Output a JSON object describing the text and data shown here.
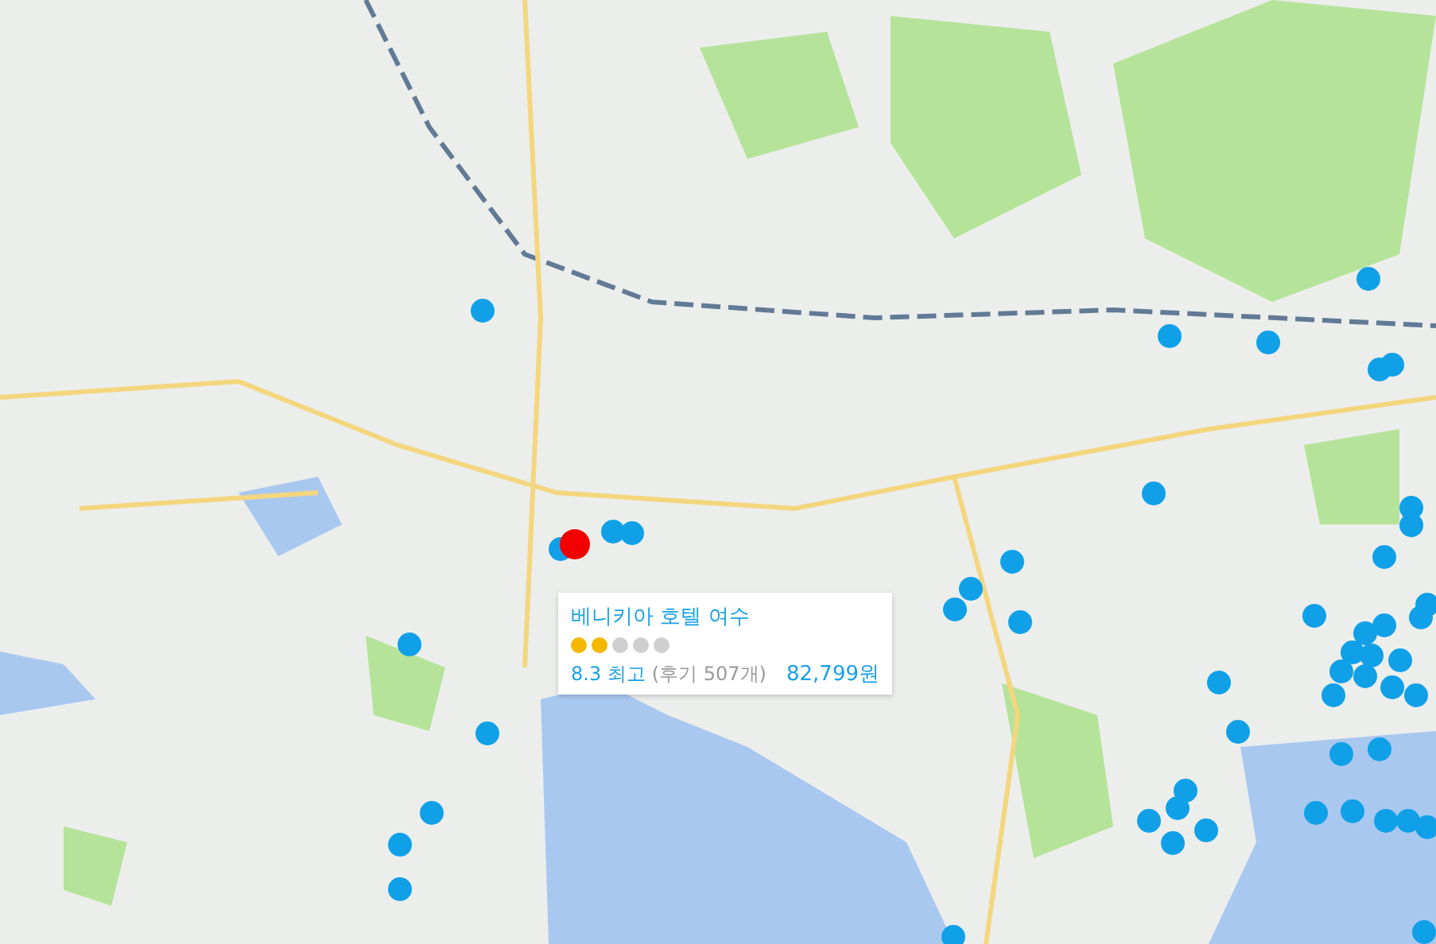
{
  "map": {
    "markers": [
      {
        "selected": false
      },
      {
        "selected": false
      },
      {
        "selected": false
      },
      {
        "selected": false
      },
      {
        "selected": false
      },
      {
        "selected": false
      },
      {
        "selected": false
      },
      {
        "selected": false
      },
      {
        "selected": false
      },
      {
        "selected": false
      },
      {
        "selected": false
      },
      {
        "selected": false
      },
      {
        "selected": false
      },
      {
        "selected": false
      },
      {
        "selected": false
      },
      {
        "selected": false
      },
      {
        "selected": false
      },
      {
        "selected": false
      },
      {
        "selected": false
      },
      {
        "selected": false
      },
      {
        "selected": false
      },
      {
        "selected": false
      },
      {
        "selected": false
      },
      {
        "selected": false
      },
      {
        "selected": false
      },
      {
        "selected": false
      },
      {
        "selected": false
      },
      {
        "selected": false
      },
      {
        "selected": false
      },
      {
        "selected": false
      },
      {
        "selected": false
      },
      {
        "selected": false
      },
      {
        "selected": false
      },
      {
        "selected": false
      },
      {
        "selected": false
      },
      {
        "selected": false
      },
      {
        "selected": false
      },
      {
        "selected": false
      },
      {
        "selected": false
      },
      {
        "selected": false
      },
      {
        "selected": false
      },
      {
        "selected": false
      },
      {
        "selected": false
      },
      {
        "selected": false
      },
      {
        "selected": false
      },
      {
        "selected": false
      },
      {
        "selected": false
      },
      {
        "selected": false
      },
      {
        "selected": false
      },
      {
        "selected": false
      },
      {
        "selected": false
      },
      {
        "selected": true
      }
    ]
  },
  "popup": {
    "name": "베니키아 호텔 여수",
    "stars": 2,
    "rating": "8.3 최고",
    "reviews": "(후기 507개)",
    "price": "82,799원"
  }
}
